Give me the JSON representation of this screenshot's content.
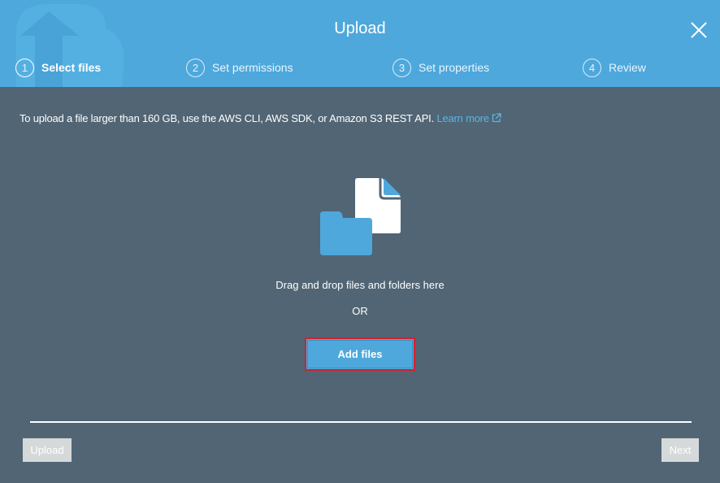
{
  "dialog": {
    "title": "Upload",
    "close_icon": "close-icon",
    "background_icon": "cloud-upload-icon"
  },
  "steps": [
    {
      "number": "1",
      "label": "Select files",
      "active": true
    },
    {
      "number": "2",
      "label": "Set permissions",
      "active": false
    },
    {
      "number": "3",
      "label": "Set properties",
      "active": false
    },
    {
      "number": "4",
      "label": "Review",
      "active": false
    }
  ],
  "info": {
    "text": "To upload a file larger than 160 GB, use the AWS CLI, AWS SDK, or Amazon S3 REST API.",
    "link_label": "Learn more",
    "link_icon": "external-link-icon"
  },
  "dropzone": {
    "icon": "files-and-folder-icon",
    "text": "Drag and drop files and folders here",
    "or_text": "OR",
    "add_files_label": "Add files"
  },
  "footer": {
    "upload_label": "Upload",
    "next_label": "Next"
  },
  "colors": {
    "header": "#4ea8dc",
    "body": "#516574",
    "link": "#5ab6e8",
    "highlight_border": "#d3202f",
    "disabled_button": "#d5d9da"
  }
}
